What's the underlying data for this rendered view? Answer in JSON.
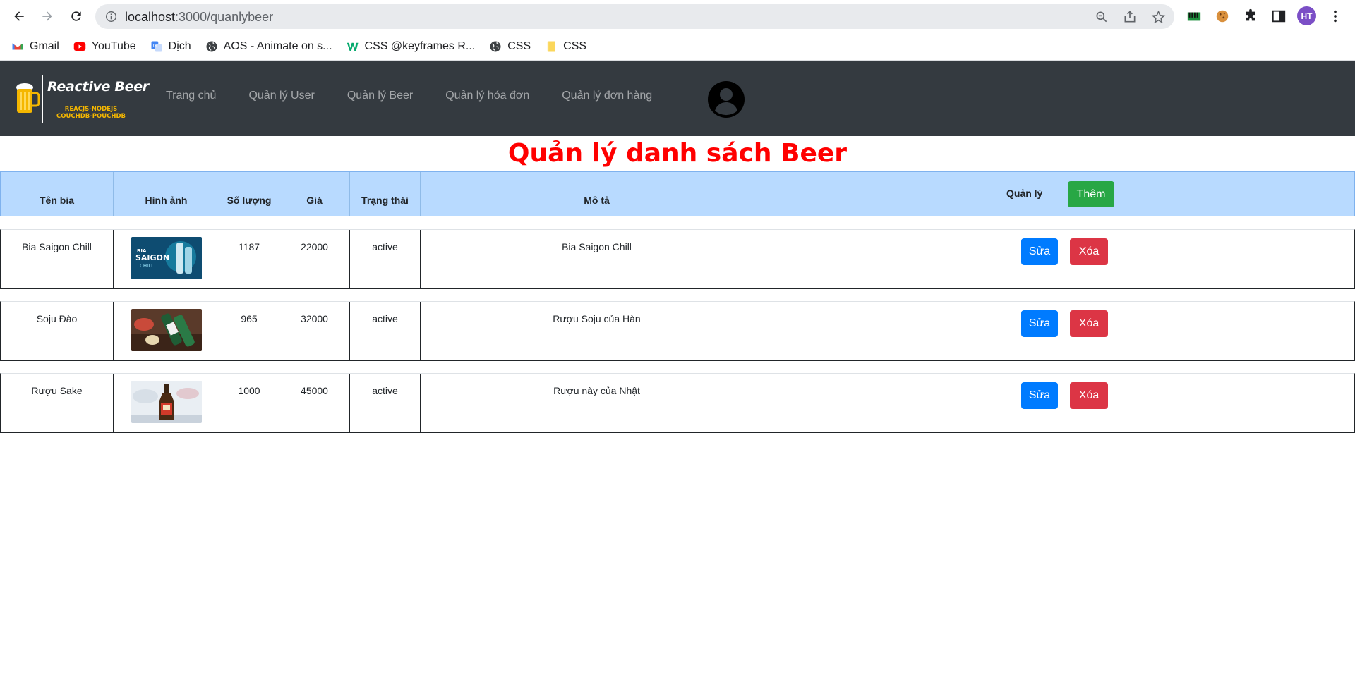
{
  "browser": {
    "url_host": "localhost",
    "url_path": ":3000/quanlybeer",
    "profile_initials": "HT",
    "bookmarks": [
      {
        "label": "Gmail",
        "icon": "gmail-icon"
      },
      {
        "label": "YouTube",
        "icon": "youtube-icon"
      },
      {
        "label": "Dịch",
        "icon": "translate-icon"
      },
      {
        "label": "AOS - Animate on s...",
        "icon": "globe-icon"
      },
      {
        "label": "CSS @keyframes R...",
        "icon": "w3schools-icon"
      },
      {
        "label": "CSS",
        "icon": "globe-icon"
      },
      {
        "label": "CSS",
        "icon": "folder-icon"
      }
    ]
  },
  "brand": {
    "title": "Reactive Beer",
    "subtitle_line1": "REACJS-NODEJS",
    "subtitle_line2": "COUCHDB-POUCHDB"
  },
  "nav": {
    "items": [
      "Trang chủ",
      "Quản lý User",
      "Quản lý Beer",
      "Quản lý hóa đơn",
      "Quản lý đơn hàng"
    ]
  },
  "page": {
    "title": "Quản lý danh sách Beer"
  },
  "table": {
    "headers": {
      "name": "Tên bia",
      "image": "Hình ảnh",
      "quantity": "Số lượng",
      "price": "Giá",
      "status": "Trạng thái",
      "description": "Mô tả",
      "manage": "Quản lý"
    },
    "add_label": "Thêm",
    "edit_label": "Sửa",
    "delete_label": "Xóa",
    "rows": [
      {
        "name": "Bia Saigon Chill",
        "quantity": "1187",
        "price": "22000",
        "status": "active",
        "description": "Bia Saigon Chill",
        "thumb": "saigon-chill-image"
      },
      {
        "name": "Soju Đào",
        "quantity": "965",
        "price": "32000",
        "status": "active",
        "description": "Rượu Soju của Hàn",
        "thumb": "soju-image"
      },
      {
        "name": "Rượu Sake",
        "quantity": "1000",
        "price": "45000",
        "status": "active",
        "description": "Rượu này của Nhật",
        "thumb": "sake-image"
      }
    ]
  },
  "colors": {
    "navbar_bg": "#343a40",
    "title_red": "#ff0000",
    "header_blue": "#b8daff",
    "add_green": "#28a745",
    "edit_blue": "#007bff",
    "delete_red": "#dc3545"
  }
}
